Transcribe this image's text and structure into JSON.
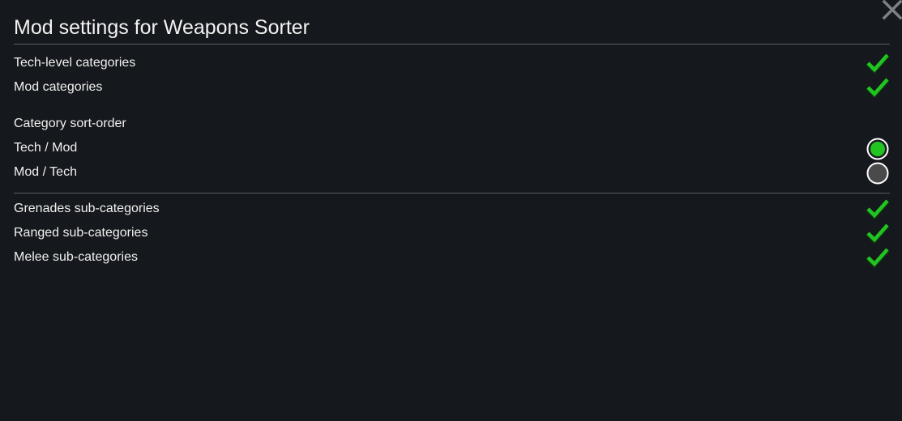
{
  "dialog": {
    "title": "Mod settings for Weapons Sorter",
    "close_icon": "close-icon"
  },
  "section1": {
    "items": [
      {
        "label": "Tech-level categories",
        "checked": true
      },
      {
        "label": "Mod categories",
        "checked": true
      }
    ]
  },
  "sort_order": {
    "heading": "Category sort-order",
    "options": [
      {
        "label": "Tech / Mod",
        "selected": true
      },
      {
        "label": "Mod / Tech",
        "selected": false
      }
    ]
  },
  "section2": {
    "items": [
      {
        "label": "Grenades sub-categories",
        "checked": true
      },
      {
        "label": "Ranged sub-categories",
        "checked": true
      },
      {
        "label": "Melee sub-categories",
        "checked": true
      }
    ]
  },
  "colors": {
    "background": "#15181c",
    "accent_green": "#22c422",
    "radio_off": "#4a4a4a",
    "divider": "#5a5e63"
  }
}
